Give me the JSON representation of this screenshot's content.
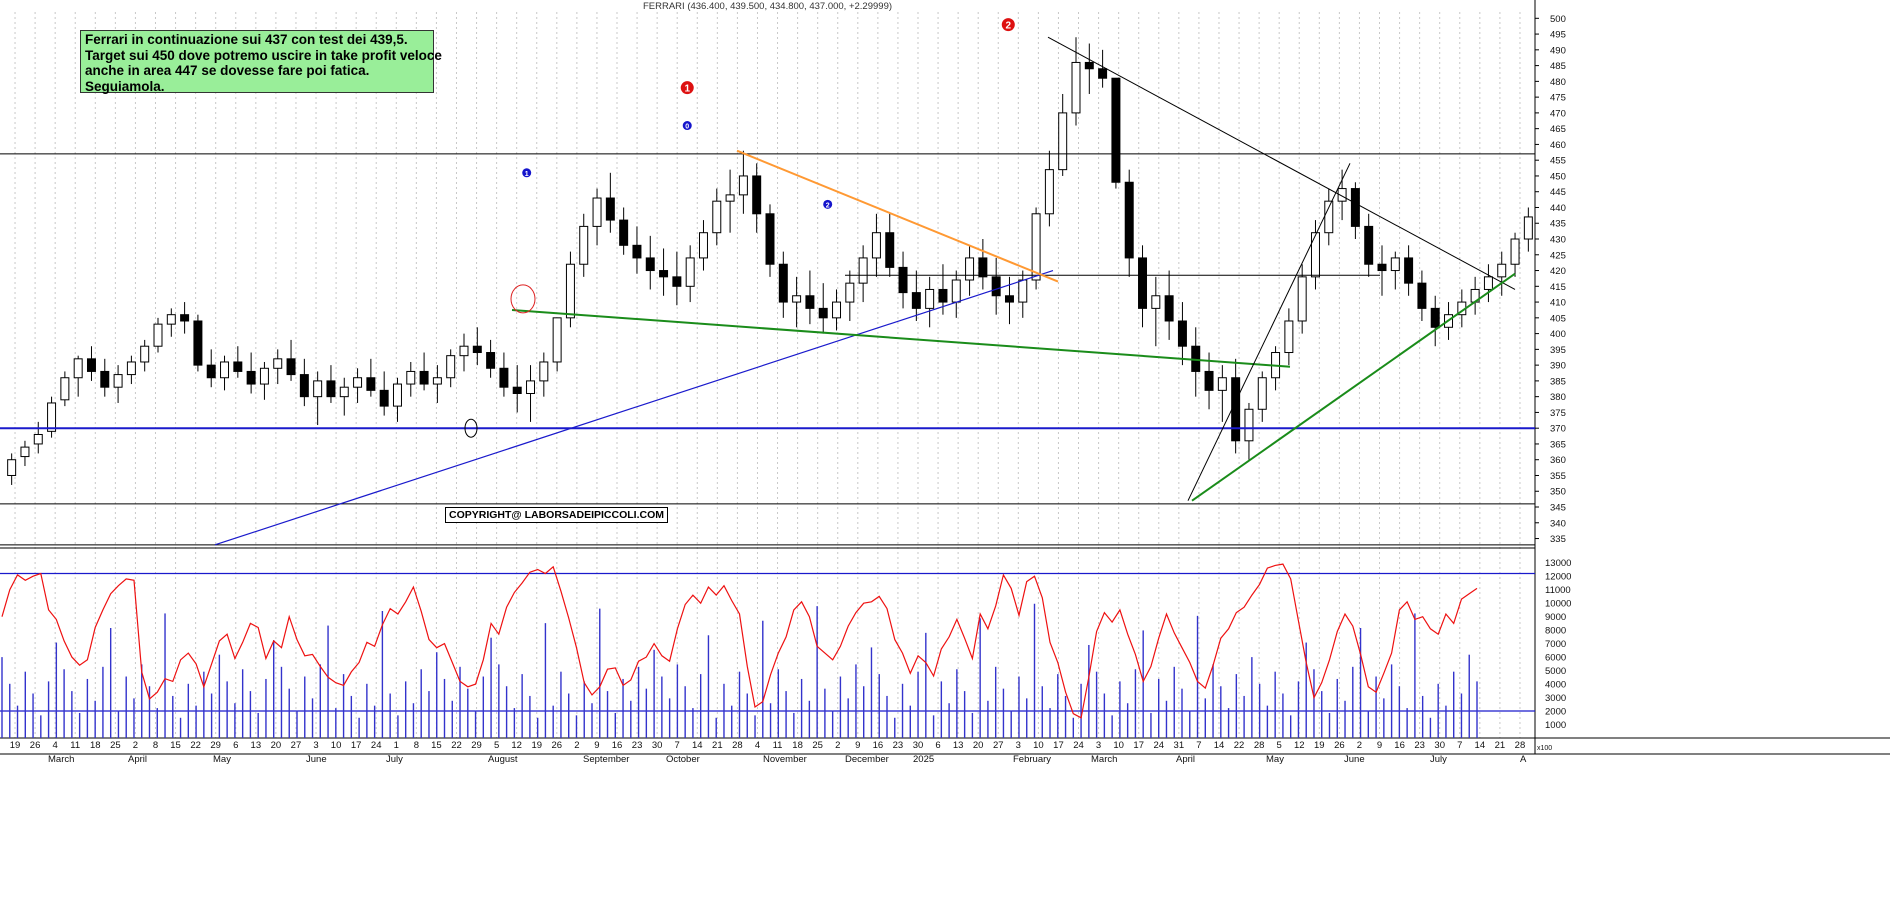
{
  "header": {
    "title": "FERRARI (436.400, 439.500, 434.800, 437.000, +2.29999)"
  },
  "annotation": {
    "lines": [
      "Ferrari in continuazione sui 437 con test dei 439,5.",
      "Target sui 450 dove potremo uscire in take profit veloce",
      "anche in area 447 se dovesse fare poi fatica.",
      "Seguiamola."
    ]
  },
  "copyright": "COPYRIGHT@ LABORSADEIPICCOLI.COM",
  "colors": {
    "candle": "#000000",
    "support": "#1a1acc",
    "green_trend": "#1a8c1a",
    "orange_trend": "#ff9933",
    "oscillator": "#ee1111",
    "volume": "#3333cc",
    "wave_blue": "#1515cc",
    "wave_red": "#dd1111"
  },
  "chart_data": [
    {
      "type": "candlestick",
      "series_name": "FERRARI",
      "y_ticks": [
        "500",
        "495",
        "490",
        "485",
        "480",
        "475",
        "470",
        "465",
        "460",
        "455",
        "450",
        "445",
        "440",
        "435",
        "430",
        "425",
        "420",
        "415",
        "410",
        "405",
        "400",
        "395",
        "390",
        "385",
        "380",
        "375",
        "370",
        "365",
        "360",
        "355",
        "350",
        "345",
        "340",
        "335"
      ],
      "ylim": [
        332,
        502
      ],
      "horizontal_levels": [
        457,
        418.5,
        370,
        346,
        333
      ],
      "wave_labels": [
        {
          "text": "1",
          "style": "small-blue",
          "week": 25.5,
          "price": 451
        },
        {
          "text": "1",
          "style": "big-red",
          "week": 33.5,
          "price": 478
        },
        {
          "text": "0",
          "style": "small-blue",
          "week": 33.5,
          "price": 466
        },
        {
          "text": "2",
          "style": "small-blue",
          "week": 40.5,
          "price": 441
        },
        {
          "text": "2",
          "style": "big-red",
          "week": 49.5,
          "price": 498
        }
      ],
      "x_labels_top": [
        "19",
        "26",
        "4",
        "11",
        "18",
        "25",
        "2",
        "8",
        "15",
        "22",
        "29",
        "6",
        "13",
        "20",
        "27",
        "3",
        "10",
        "17",
        "24",
        "1",
        "8",
        "15",
        "22",
        "29",
        "5",
        "12",
        "19",
        "26",
        "2",
        "9",
        "16",
        "23",
        "30",
        "7",
        "14",
        "21",
        "28",
        "4",
        "11",
        "18",
        "25",
        "2",
        "9",
        "16",
        "23",
        "30",
        "6",
        "13",
        "20",
        "27",
        "3",
        "10",
        "17",
        "24",
        "3",
        "10",
        "17",
        "24",
        "31",
        "7",
        "14",
        "22",
        "28",
        "5",
        "12",
        "19",
        "26",
        "2",
        "9",
        "16",
        "23",
        "30",
        "7",
        "14",
        "21",
        "28"
      ],
      "month_labels": [
        "March",
        "April",
        "May",
        "June",
        "July",
        "August",
        "September",
        "October",
        "November",
        "December",
        "2025",
        "February",
        "March",
        "April",
        "May",
        "June",
        "July",
        "A"
      ],
      "ohlc_approx": [
        [
          355,
          362,
          352,
          360
        ],
        [
          361,
          366,
          358,
          364
        ],
        [
          365,
          372,
          362,
          368
        ],
        [
          369,
          380,
          367,
          378
        ],
        [
          379,
          388,
          377,
          386
        ],
        [
          386,
          393,
          380,
          392
        ],
        [
          392,
          396,
          385,
          388
        ],
        [
          388,
          392,
          380,
          383
        ],
        [
          383,
          390,
          378,
          387
        ],
        [
          387,
          393,
          384,
          391
        ],
        [
          391,
          398,
          388,
          396
        ],
        [
          396,
          405,
          394,
          403
        ],
        [
          403,
          408,
          399,
          406
        ],
        [
          406,
          410,
          400,
          404
        ],
        [
          404,
          406,
          388,
          390
        ],
        [
          390,
          395,
          383,
          386
        ],
        [
          386,
          393,
          382,
          391
        ],
        [
          391,
          396,
          386,
          388
        ],
        [
          388,
          394,
          381,
          384
        ],
        [
          384,
          391,
          379,
          389
        ],
        [
          389,
          395,
          384,
          392
        ],
        [
          392,
          398,
          385,
          387
        ],
        [
          387,
          392,
          377,
          380
        ],
        [
          380,
          388,
          371,
          385
        ],
        [
          385,
          390,
          378,
          380
        ],
        [
          380,
          386,
          374,
          383
        ],
        [
          383,
          389,
          378,
          386
        ],
        [
          386,
          392,
          380,
          382
        ],
        [
          382,
          388,
          374,
          377
        ],
        [
          377,
          386,
          372,
          384
        ],
        [
          384,
          391,
          380,
          388
        ],
        [
          388,
          394,
          382,
          384
        ],
        [
          384,
          390,
          378,
          386
        ],
        [
          386,
          395,
          383,
          393
        ],
        [
          393,
          400,
          388,
          396
        ],
        [
          396,
          402,
          390,
          394
        ],
        [
          394,
          398,
          386,
          389
        ],
        [
          389,
          394,
          380,
          383
        ],
        [
          383,
          390,
          375,
          381
        ],
        [
          381,
          390,
          372,
          385
        ],
        [
          385,
          394,
          380,
          391
        ],
        [
          391,
          405,
          388,
          405
        ],
        [
          405,
          426,
          402,
          422
        ],
        [
          422,
          438,
          418,
          434
        ],
        [
          434,
          446,
          428,
          443
        ],
        [
          443,
          451,
          432,
          436
        ],
        [
          436,
          440,
          425,
          428
        ],
        [
          428,
          434,
          419,
          424
        ],
        [
          424,
          431,
          414,
          420
        ],
        [
          420,
          427,
          412,
          418
        ],
        [
          418,
          426,
          409,
          415
        ],
        [
          415,
          428,
          410,
          424
        ],
        [
          424,
          436,
          420,
          432
        ],
        [
          432,
          446,
          428,
          442
        ],
        [
          442,
          452,
          432,
          444
        ],
        [
          444,
          458,
          438,
          450
        ],
        [
          450,
          454,
          432,
          438
        ],
        [
          438,
          441,
          418,
          422
        ],
        [
          422,
          426,
          405,
          410
        ],
        [
          410,
          418,
          402,
          412
        ],
        [
          412,
          420,
          403,
          408
        ],
        [
          408,
          416,
          400,
          405
        ],
        [
          405,
          414,
          401,
          410
        ],
        [
          410,
          420,
          404,
          416
        ],
        [
          416,
          428,
          410,
          424
        ],
        [
          424,
          438,
          418,
          432
        ],
        [
          432,
          438,
          418,
          421
        ],
        [
          421,
          426,
          408,
          413
        ],
        [
          413,
          420,
          404,
          408
        ],
        [
          408,
          418,
          402,
          414
        ],
        [
          414,
          422,
          406,
          410
        ],
        [
          410,
          420,
          405,
          417
        ],
        [
          417,
          428,
          412,
          424
        ],
        [
          424,
          430,
          414,
          418
        ],
        [
          418,
          424,
          406,
          412
        ],
        [
          412,
          418,
          403,
          410
        ],
        [
          410,
          420,
          405,
          417
        ],
        [
          417,
          440,
          414,
          438
        ],
        [
          438,
          458,
          434,
          452
        ],
        [
          452,
          476,
          450,
          470
        ],
        [
          470,
          494,
          466,
          486
        ],
        [
          486,
          492,
          476,
          484
        ],
        [
          484,
          490,
          478,
          481
        ],
        [
          481,
          458,
          446,
          448
        ],
        [
          448,
          452,
          418,
          424
        ],
        [
          424,
          428,
          402,
          408
        ],
        [
          408,
          418,
          396,
          412
        ],
        [
          412,
          420,
          398,
          404
        ],
        [
          404,
          410,
          390,
          396
        ],
        [
          396,
          402,
          380,
          388
        ],
        [
          388,
          394,
          376,
          382
        ],
        [
          382,
          390,
          372,
          386
        ],
        [
          386,
          392,
          362,
          366
        ],
        [
          366,
          378,
          360,
          376
        ],
        [
          376,
          388,
          372,
          386
        ],
        [
          386,
          396,
          382,
          394
        ],
        [
          394,
          408,
          390,
          404
        ],
        [
          404,
          422,
          400,
          418
        ],
        [
          418,
          436,
          414,
          432
        ],
        [
          432,
          446,
          428,
          442
        ],
        [
          442,
          452,
          436,
          446
        ],
        [
          446,
          448,
          430,
          434
        ],
        [
          434,
          438,
          418,
          422
        ],
        [
          422,
          428,
          412,
          420
        ],
        [
          420,
          426,
          414,
          424
        ],
        [
          424,
          428,
          412,
          416
        ],
        [
          416,
          420,
          404,
          408
        ],
        [
          408,
          412,
          396,
          402
        ],
        [
          402,
          410,
          398,
          406
        ],
        [
          406,
          414,
          402,
          410
        ],
        [
          410,
          418,
          406,
          414
        ],
        [
          414,
          422,
          410,
          418
        ],
        [
          418,
          426,
          412,
          422
        ],
        [
          422,
          432,
          418,
          430
        ],
        [
          430,
          440,
          426,
          437
        ]
      ]
    },
    {
      "type": "line+bar",
      "series": [
        {
          "name": "oscillator",
          "kind": "line"
        },
        {
          "name": "volume",
          "kind": "bar"
        }
      ],
      "y_ticks": [
        "13000",
        "12000",
        "11000",
        "10000",
        "9000",
        "8000",
        "7000",
        "6000",
        "5000",
        "4000",
        "3000",
        "2000",
        "1000"
      ],
      "ylim": [
        0,
        13500
      ],
      "horizontal_levels": [
        12200,
        2000
      ],
      "axis_unit": "x100",
      "oscillator_values": [
        9000,
        11000,
        12100,
        11700,
        12000,
        12200,
        9500,
        8800,
        7200,
        6000,
        5400,
        5800,
        8200,
        9500,
        10700,
        11300,
        11800,
        11700,
        4900,
        2900,
        3400,
        4400,
        4200,
        5800,
        6300,
        5500,
        3800,
        5500,
        7200,
        7700,
        5900,
        7100,
        8500,
        8200,
        5900,
        7200,
        6700,
        9000,
        7300,
        6100,
        6200,
        5300,
        4500,
        4100,
        3900,
        4900,
        5600,
        7100,
        6800,
        8400,
        9600,
        9200,
        10100,
        11200,
        9400,
        7300,
        6700,
        7000,
        5600,
        4200,
        3800,
        4000,
        5800,
        8500,
        7700,
        9700,
        10800,
        11500,
        12300,
        12500,
        12200,
        12700,
        10900,
        8900,
        6700,
        4100,
        3200,
        3800,
        5100,
        5200,
        3900,
        4300,
        5700,
        6000,
        7000,
        6100,
        5700,
        8100,
        9900,
        10600,
        10000,
        11200,
        10600,
        11300,
        10200,
        9200,
        5300,
        2300,
        2700,
        4700,
        6300,
        7500,
        9500,
        10100,
        9000,
        6800,
        6300,
        5800,
        6800,
        8300,
        9300,
        10000,
        10100,
        10500,
        9600,
        7300,
        6300,
        4800,
        6100,
        5600,
        4600,
        6600,
        7500,
        8800,
        7400,
        5900,
        9200,
        8100,
        9800,
        12100,
        11100,
        9100,
        11600,
        12000,
        10400,
        7100,
        5600,
        3400,
        1800,
        1500,
        4500,
        7900,
        9300,
        8600,
        9500,
        7700,
        6200,
        4200,
        5300,
        7400,
        9200,
        7800,
        6700,
        5600,
        4200,
        3700,
        5400,
        7400,
        8100,
        9300,
        9700,
        10600,
        11400,
        12600,
        12800,
        12900,
        11800,
        8700,
        5600,
        3000,
        4100,
        5800,
        7900,
        9200,
        8300,
        6200,
        3800,
        3400,
        4800,
        6300,
        9500,
        10100,
        8800,
        9000,
        8100,
        7700,
        9200,
        8500,
        10300,
        10700,
        11100
      ]
    }
  ]
}
